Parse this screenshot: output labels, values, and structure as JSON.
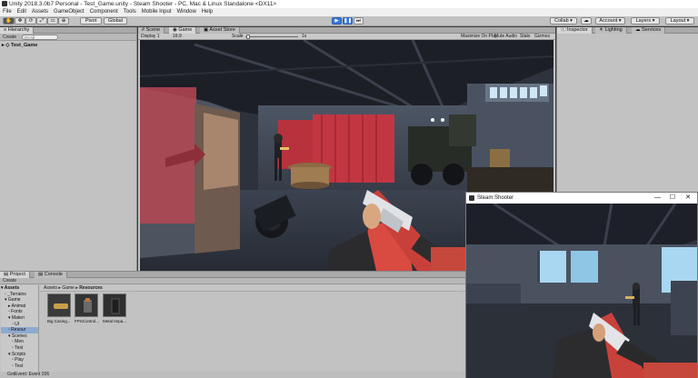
{
  "window": {
    "title": "Unity 2018.3.0b7 Personal - Test_Game.unity - Steam Shooter - PC, Mac & Linux Standalone <DX11>"
  },
  "menu": [
    "File",
    "Edit",
    "Assets",
    "GameObject",
    "Component",
    "Tools",
    "Mobile Input",
    "Window",
    "Help"
  ],
  "toolbar": {
    "pivot": "Pivot",
    "global": "Global",
    "collab": "Collab",
    "account": "Account",
    "layers": "Layers",
    "layout": "Layout"
  },
  "hierarchy": {
    "tab": "Hierarchy",
    "create": "Create",
    "search_placeholder": "Q+All",
    "scene": "Test_Game"
  },
  "center_tabs": [
    "Scene",
    "Game",
    "Asset Store"
  ],
  "game_bar": {
    "display": "Display 1",
    "aspect": "16:9",
    "scale_label": "Scale",
    "scale_value": "1x",
    "maximize": "Maximize On Play",
    "mute": "Mute Audio",
    "stats": "Stats",
    "gizmos": "Gizmos"
  },
  "right_tabs": [
    "Inspector",
    "Lighting",
    "Services"
  ],
  "project": {
    "tabs": [
      "Project",
      "Console"
    ],
    "create": "Create",
    "breadcrumb": [
      "Assets",
      "Game",
      "Resources"
    ],
    "tree": [
      "Assets",
      "_Terrains",
      "Game",
      "Animat",
      "Fonts",
      "Materi",
      "UI",
      "Resour",
      "Scenes",
      "Men",
      "Test",
      "Scripts",
      "Play",
      "Test"
    ],
    "assets": [
      {
        "label": "Big Casing..."
      },
      {
        "label": "FPSControl..."
      },
      {
        "label": "Metal Impa..."
      }
    ]
  },
  "status": "GotEvent: Event 206",
  "popup": {
    "title": "Steam Shooter"
  }
}
